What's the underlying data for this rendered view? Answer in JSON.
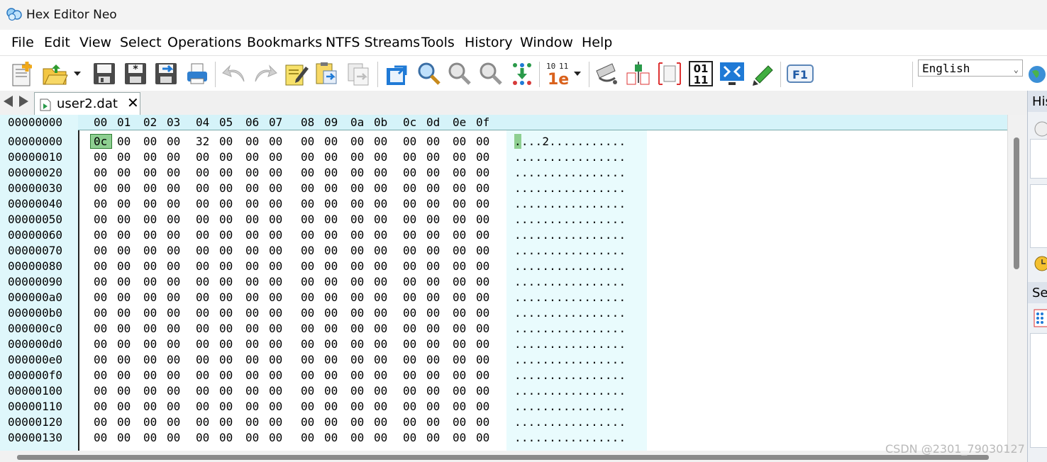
{
  "window": {
    "title": "Hex Editor Neo",
    "app_icon": "hex-editor-neo-logo-icon"
  },
  "menu": [
    "File",
    "Edit",
    "View",
    "Select",
    "Operations",
    "Bookmarks",
    "NTFS Streams",
    "Tools",
    "History",
    "Window",
    "Help"
  ],
  "toolbar": {
    "buttons": [
      "new-file-icon",
      "open-file-icon",
      "open-dropdown-icon",
      "save-icon",
      "save-all-icon",
      "save-as-icon",
      "print-icon",
      "undo-icon",
      "redo-icon",
      "edit-icon",
      "paste-icon",
      "copy-icon",
      "goto-icon",
      "find-icon",
      "find-next-icon",
      "find-previous-icon",
      "pattern-coloring-icon",
      "base-converter-icon",
      "base-dropdown-icon",
      "ntfs-stream-icon",
      "compare-icon",
      "structure-icon",
      "binary-mode-icon",
      "fullscreen-icon",
      "modify-icon",
      "help-f1-icon"
    ],
    "language": {
      "selected": "English"
    },
    "binary_label_top": "01",
    "binary_label_bottom": "11",
    "help_label": "F1"
  },
  "tabs": [
    {
      "label": "user2.dat",
      "close": "✕",
      "active": true
    }
  ],
  "editor": {
    "header_address": "00000000",
    "columns": [
      "00",
      "01",
      "02",
      "03",
      "04",
      "05",
      "06",
      "07",
      "08",
      "09",
      "0a",
      "0b",
      "0c",
      "0d",
      "0e",
      "0f"
    ],
    "selected_offset": "00000000",
    "selected_byte": "0c",
    "rows": [
      {
        "addr": "00000000",
        "bytes": [
          "0c",
          "00",
          "00",
          "00",
          "32",
          "00",
          "00",
          "00",
          "00",
          "00",
          "00",
          "00",
          "00",
          "00",
          "00",
          "00"
        ],
        "text": "....2..........."
      },
      {
        "addr": "00000010",
        "bytes": [
          "00",
          "00",
          "00",
          "00",
          "00",
          "00",
          "00",
          "00",
          "00",
          "00",
          "00",
          "00",
          "00",
          "00",
          "00",
          "00"
        ],
        "text": "................"
      },
      {
        "addr": "00000020",
        "bytes": [
          "00",
          "00",
          "00",
          "00",
          "00",
          "00",
          "00",
          "00",
          "00",
          "00",
          "00",
          "00",
          "00",
          "00",
          "00",
          "00"
        ],
        "text": "................"
      },
      {
        "addr": "00000030",
        "bytes": [
          "00",
          "00",
          "00",
          "00",
          "00",
          "00",
          "00",
          "00",
          "00",
          "00",
          "00",
          "00",
          "00",
          "00",
          "00",
          "00"
        ],
        "text": "................"
      },
      {
        "addr": "00000040",
        "bytes": [
          "00",
          "00",
          "00",
          "00",
          "00",
          "00",
          "00",
          "00",
          "00",
          "00",
          "00",
          "00",
          "00",
          "00",
          "00",
          "00"
        ],
        "text": "................"
      },
      {
        "addr": "00000050",
        "bytes": [
          "00",
          "00",
          "00",
          "00",
          "00",
          "00",
          "00",
          "00",
          "00",
          "00",
          "00",
          "00",
          "00",
          "00",
          "00",
          "00"
        ],
        "text": "................"
      },
      {
        "addr": "00000060",
        "bytes": [
          "00",
          "00",
          "00",
          "00",
          "00",
          "00",
          "00",
          "00",
          "00",
          "00",
          "00",
          "00",
          "00",
          "00",
          "00",
          "00"
        ],
        "text": "................"
      },
      {
        "addr": "00000070",
        "bytes": [
          "00",
          "00",
          "00",
          "00",
          "00",
          "00",
          "00",
          "00",
          "00",
          "00",
          "00",
          "00",
          "00",
          "00",
          "00",
          "00"
        ],
        "text": "................"
      },
      {
        "addr": "00000080",
        "bytes": [
          "00",
          "00",
          "00",
          "00",
          "00",
          "00",
          "00",
          "00",
          "00",
          "00",
          "00",
          "00",
          "00",
          "00",
          "00",
          "00"
        ],
        "text": "................"
      },
      {
        "addr": "00000090",
        "bytes": [
          "00",
          "00",
          "00",
          "00",
          "00",
          "00",
          "00",
          "00",
          "00",
          "00",
          "00",
          "00",
          "00",
          "00",
          "00",
          "00"
        ],
        "text": "................"
      },
      {
        "addr": "000000a0",
        "bytes": [
          "00",
          "00",
          "00",
          "00",
          "00",
          "00",
          "00",
          "00",
          "00",
          "00",
          "00",
          "00",
          "00",
          "00",
          "00",
          "00"
        ],
        "text": "................"
      },
      {
        "addr": "000000b0",
        "bytes": [
          "00",
          "00",
          "00",
          "00",
          "00",
          "00",
          "00",
          "00",
          "00",
          "00",
          "00",
          "00",
          "00",
          "00",
          "00",
          "00"
        ],
        "text": "................"
      },
      {
        "addr": "000000c0",
        "bytes": [
          "00",
          "00",
          "00",
          "00",
          "00",
          "00",
          "00",
          "00",
          "00",
          "00",
          "00",
          "00",
          "00",
          "00",
          "00",
          "00"
        ],
        "text": "................"
      },
      {
        "addr": "000000d0",
        "bytes": [
          "00",
          "00",
          "00",
          "00",
          "00",
          "00",
          "00",
          "00",
          "00",
          "00",
          "00",
          "00",
          "00",
          "00",
          "00",
          "00"
        ],
        "text": "................"
      },
      {
        "addr": "000000e0",
        "bytes": [
          "00",
          "00",
          "00",
          "00",
          "00",
          "00",
          "00",
          "00",
          "00",
          "00",
          "00",
          "00",
          "00",
          "00",
          "00",
          "00"
        ],
        "text": "................"
      },
      {
        "addr": "000000f0",
        "bytes": [
          "00",
          "00",
          "00",
          "00",
          "00",
          "00",
          "00",
          "00",
          "00",
          "00",
          "00",
          "00",
          "00",
          "00",
          "00",
          "00"
        ],
        "text": "................"
      },
      {
        "addr": "00000100",
        "bytes": [
          "00",
          "00",
          "00",
          "00",
          "00",
          "00",
          "00",
          "00",
          "00",
          "00",
          "00",
          "00",
          "00",
          "00",
          "00",
          "00"
        ],
        "text": "................"
      },
      {
        "addr": "00000110",
        "bytes": [
          "00",
          "00",
          "00",
          "00",
          "00",
          "00",
          "00",
          "00",
          "00",
          "00",
          "00",
          "00",
          "00",
          "00",
          "00",
          "00"
        ],
        "text": "................"
      },
      {
        "addr": "00000120",
        "bytes": [
          "00",
          "00",
          "00",
          "00",
          "00",
          "00",
          "00",
          "00",
          "00",
          "00",
          "00",
          "00",
          "00",
          "00",
          "00",
          "00"
        ],
        "text": "................"
      },
      {
        "addr": "00000130",
        "bytes": [
          "00",
          "00",
          "00",
          "00",
          "00",
          "00",
          "00",
          "00",
          "00",
          "00",
          "00",
          "00",
          "00",
          "00",
          "00",
          "00"
        ],
        "text": "................"
      }
    ]
  },
  "right_panel": {
    "history_title": "His",
    "selection_title": "Sel"
  },
  "watermark": "CSDN @2301_79030127",
  "colors": {
    "address_bg": "#dff7fb",
    "header_bg": "#d5f3f9",
    "selection": "#8ecf91",
    "text_pane_bg": "#e9fbfd",
    "toolbar_blue": "#1f7ad6"
  }
}
